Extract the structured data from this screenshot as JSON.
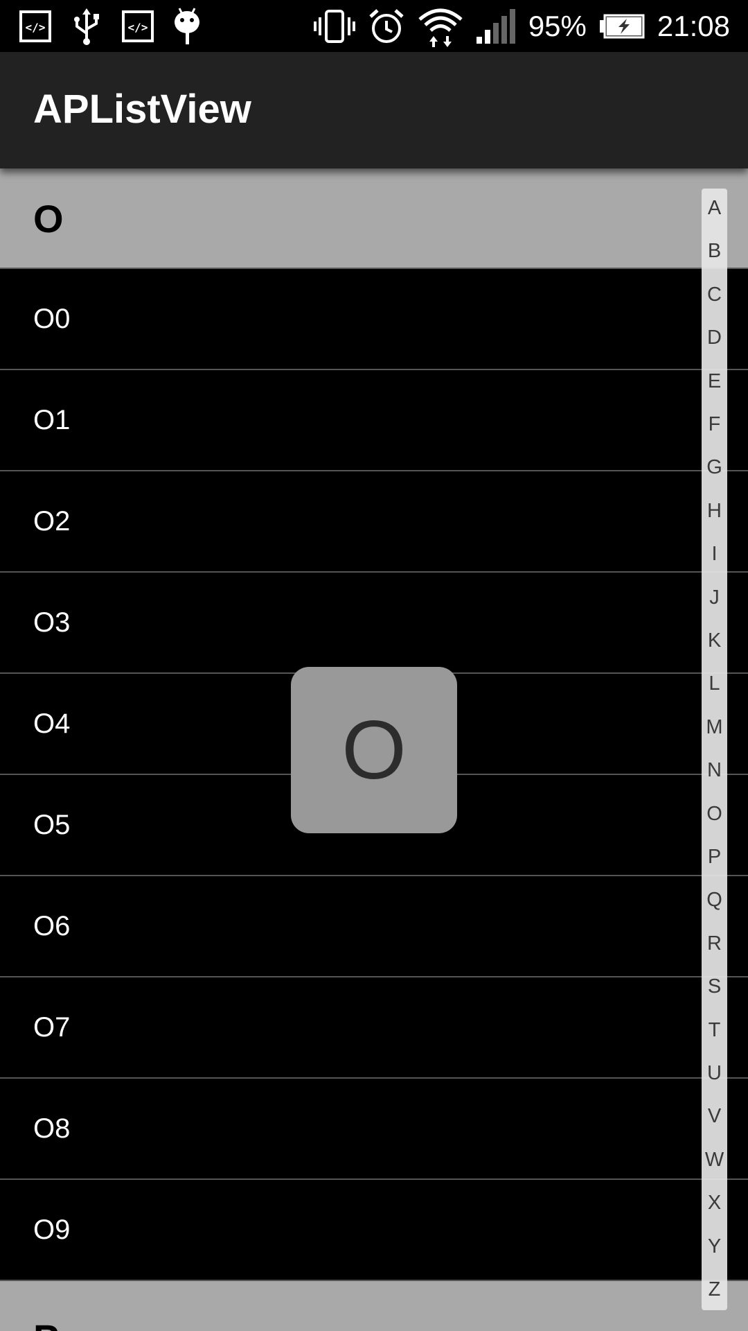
{
  "status_bar": {
    "left_icons": [
      "code-icon",
      "usb-icon",
      "code-icon",
      "android-icon"
    ],
    "right_icons": [
      "vibrate-icon",
      "alarm-icon",
      "wifi-icon",
      "signal-icon"
    ],
    "battery_percent": "95%",
    "battery_level": 0.95,
    "time": "21:08"
  },
  "app_bar": {
    "title": "APListView"
  },
  "list": {
    "current_section": "O",
    "items": [
      "O0",
      "O1",
      "O2",
      "O3",
      "O4",
      "O5",
      "O6",
      "O7",
      "O8",
      "O9"
    ],
    "next_section": "P"
  },
  "index_bar": {
    "letters": [
      "A",
      "B",
      "C",
      "D",
      "E",
      "F",
      "G",
      "H",
      "I",
      "J",
      "K",
      "L",
      "M",
      "N",
      "O",
      "P",
      "Q",
      "R",
      "S",
      "T",
      "U",
      "V",
      "W",
      "X",
      "Y",
      "Z"
    ]
  },
  "overlay": {
    "letter": "O"
  },
  "colors": {
    "app_bar_bg": "#222222",
    "section_header_bg": "#a9a9a9",
    "list_bg": "#000000",
    "overlay_bg": "#999999",
    "index_bar_bg": "#e6e6e6"
  }
}
